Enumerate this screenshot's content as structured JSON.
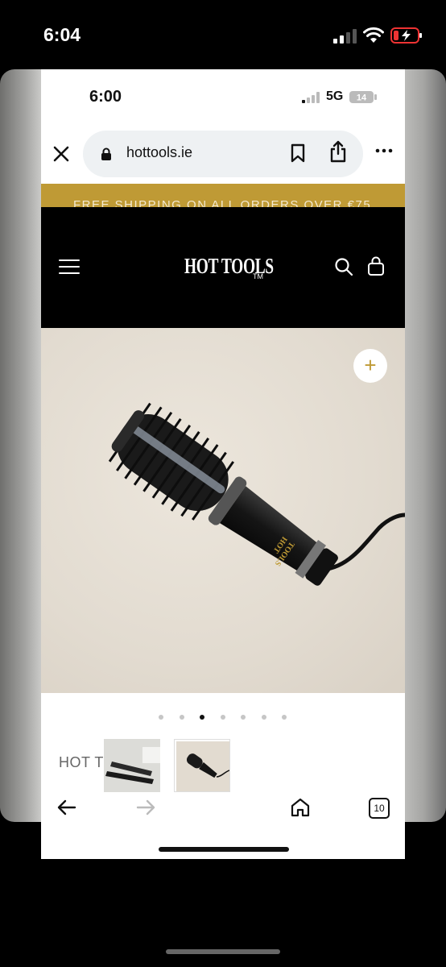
{
  "outer_status": {
    "time": "6:04"
  },
  "inner_status": {
    "time": "6:00",
    "network": "5G",
    "battery": "14"
  },
  "browser": {
    "url": "hottools.ie",
    "close_icon": "close-icon",
    "lock_icon": "lock-icon",
    "bookmark_icon": "bookmark-icon",
    "share_icon": "share-icon",
    "more_icon": "more-icon"
  },
  "promo_banner": {
    "text": "FREE SHIPPING ON ALL ORDERS OVER €75"
  },
  "site_header": {
    "logo": "HOT TOOLS",
    "logo_tm": "TM"
  },
  "product": {
    "name_partial": "HOT T",
    "carousel": {
      "total": 7,
      "active_index": 2
    }
  },
  "browser_nav": {
    "tab_count": "10"
  },
  "colors": {
    "accent": "#bf9a35",
    "header_bg": "#000000"
  }
}
